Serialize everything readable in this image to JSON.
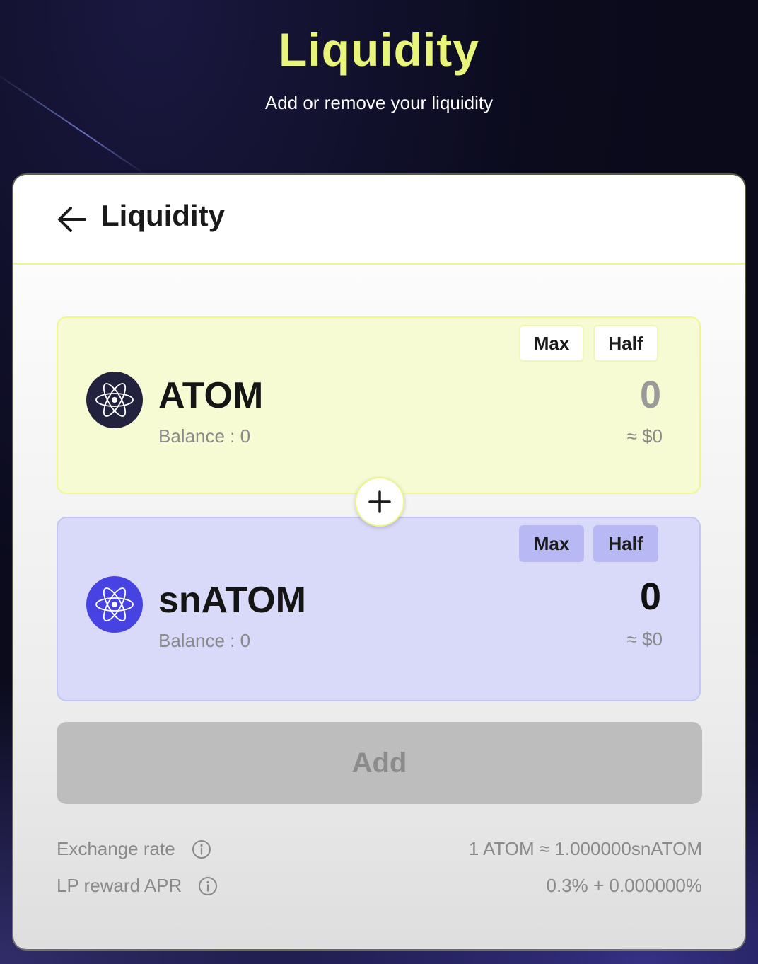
{
  "page": {
    "title": "Liquidity",
    "subtitle": "Add or remove your liquidity"
  },
  "card": {
    "title": "Liquidity"
  },
  "tokens": [
    {
      "symbol": "ATOM",
      "balance_label": "Balance : 0",
      "amount": "0",
      "usd_value": "≈ $0",
      "max_label": "Max",
      "half_label": "Half",
      "icon": "cosmos-atom-icon",
      "icon_color": "#23223e"
    },
    {
      "symbol": "snATOM",
      "balance_label": "Balance : 0",
      "amount": "0",
      "usd_value": "≈ $0",
      "max_label": "Max",
      "half_label": "Half",
      "icon": "cosmos-atom-icon",
      "icon_color": "#4742e2"
    }
  ],
  "add_button": {
    "label": "Add"
  },
  "info": {
    "exchange_rate_label": "Exchange rate",
    "exchange_rate_value": "1 ATOM ≈ 1.000000snATOM",
    "lp_apr_label": "LP reward APR",
    "lp_apr_value": "0.3% + 0.000000%"
  },
  "colors": {
    "accent_yellow": "#e8f57a",
    "atom_box_bg": "#f7fbd4",
    "snatom_box_bg": "#d9daf9",
    "disabled_button": "#bdbdbd"
  }
}
